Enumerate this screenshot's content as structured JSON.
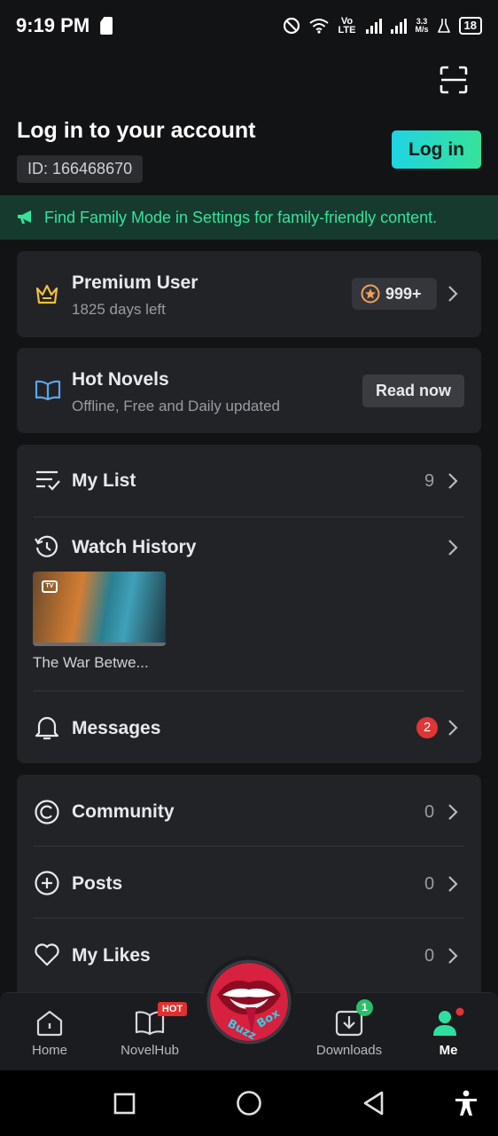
{
  "status_bar": {
    "time": "9:19 PM",
    "network": "Vo LTE",
    "speed_value": "3.3",
    "speed_unit": "M/s",
    "battery": "18"
  },
  "header": {
    "title": "Log in to your account",
    "user_id": "ID: 166468670",
    "login_label": "Log in"
  },
  "banner": {
    "text": "Find Family Mode in Settings for family-friendly content."
  },
  "premium": {
    "title": "Premium User",
    "subtitle": "1825 days left",
    "coins": "999+"
  },
  "novels": {
    "title": "Hot Novels",
    "subtitle": "Offline, Free and Daily updated",
    "button": "Read now"
  },
  "library": {
    "my_list": {
      "label": "My List",
      "count": "9"
    },
    "watch_history": {
      "label": "Watch History",
      "item_title": "The War Betwe..."
    },
    "messages": {
      "label": "Messages",
      "badge": "2"
    }
  },
  "social": {
    "community": {
      "label": "Community",
      "count": "0"
    },
    "posts": {
      "label": "Posts",
      "count": "0"
    },
    "likes": {
      "label": "My Likes",
      "count": "0"
    }
  },
  "bottom_nav": {
    "home": "Home",
    "novelhub": "NovelHub",
    "hot_badge": "HOT",
    "downloads": "Downloads",
    "downloads_badge": "1",
    "me": "Me",
    "logo_text": "Buzz Box"
  },
  "colors": {
    "accent_green": "#36e39a",
    "accent_cyan": "#1fd4e2",
    "badge_red": "#e03535",
    "card_bg": "#222327"
  },
  "icons": [
    "scan-icon",
    "megaphone-icon",
    "crown-icon",
    "coin-icon",
    "book-icon",
    "list-check-icon",
    "history-icon",
    "bell-icon",
    "community-icon",
    "plus-circle-icon",
    "heart-icon",
    "home-icon",
    "book-open-icon",
    "download-icon",
    "profile-icon",
    "chevron-right-icon"
  ]
}
